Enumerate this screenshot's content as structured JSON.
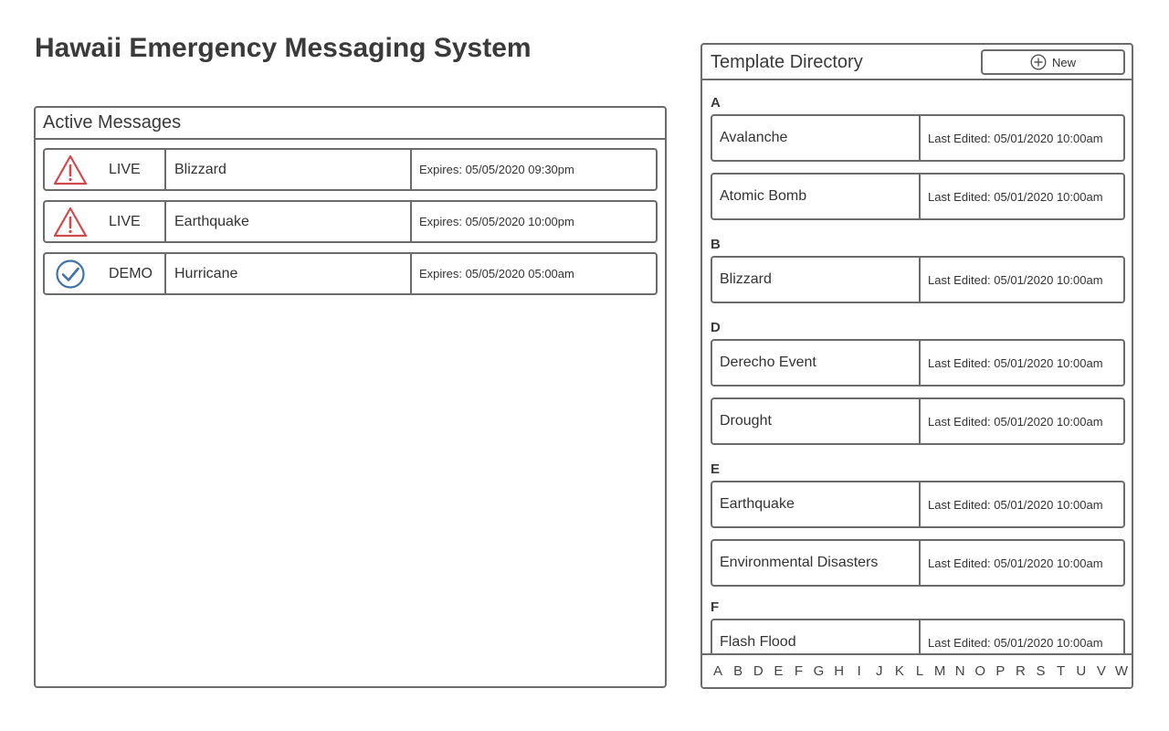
{
  "page": {
    "title": "Hawaii Emergency Messaging System"
  },
  "colors": {
    "border": "#6b6b6b",
    "alert": "#d0494d",
    "demo": "#3f72a8"
  },
  "active_messages": {
    "title": "Active Messages",
    "rows": [
      {
        "icon": "warning-icon",
        "status": "LIVE",
        "name": "Blizzard",
        "expires": "Expires: 05/05/2020 09:30pm"
      },
      {
        "icon": "warning-icon",
        "status": "LIVE",
        "name": "Earthquake",
        "expires": "Expires: 05/05/2020 10:00pm"
      },
      {
        "icon": "check-circle-icon",
        "status": "DEMO",
        "name": "Hurricane",
        "expires": "Expires: 05/05/2020 05:00am"
      }
    ]
  },
  "template_directory": {
    "title": "Template Directory",
    "new_label": "New",
    "sections": [
      {
        "letter": "A",
        "items": [
          {
            "name": "Avalanche",
            "edited": "Last Edited: 05/01/2020 10:00am"
          },
          {
            "name": "Atomic Bomb",
            "edited": "Last Edited: 05/01/2020 10:00am"
          }
        ]
      },
      {
        "letter": "B",
        "items": [
          {
            "name": "Blizzard",
            "edited": "Last Edited: 05/01/2020 10:00am"
          }
        ]
      },
      {
        "letter": "D",
        "items": [
          {
            "name": "Derecho Event",
            "edited": "Last Edited: 05/01/2020 10:00am"
          },
          {
            "name": "Drought",
            "edited": "Last Edited: 05/01/2020 10:00am"
          }
        ]
      },
      {
        "letter": "E",
        "items": [
          {
            "name": "Earthquake",
            "edited": "Last Edited: 05/01/2020 10:00am"
          },
          {
            "name": "Environmental Disasters",
            "edited": "Last Edited: 05/01/2020 10:00am"
          }
        ]
      },
      {
        "letter": "F",
        "items": [
          {
            "name": "Flash Flood",
            "edited": "Last Edited: 05/01/2020 10:00am"
          }
        ]
      }
    ],
    "alphabet": [
      "A",
      "B",
      "D",
      "E",
      "F",
      "G",
      "H",
      "I",
      "J",
      "K",
      "L",
      "M",
      "N",
      "O",
      "P",
      "R",
      "S",
      "T",
      "U",
      "V",
      "W"
    ]
  }
}
